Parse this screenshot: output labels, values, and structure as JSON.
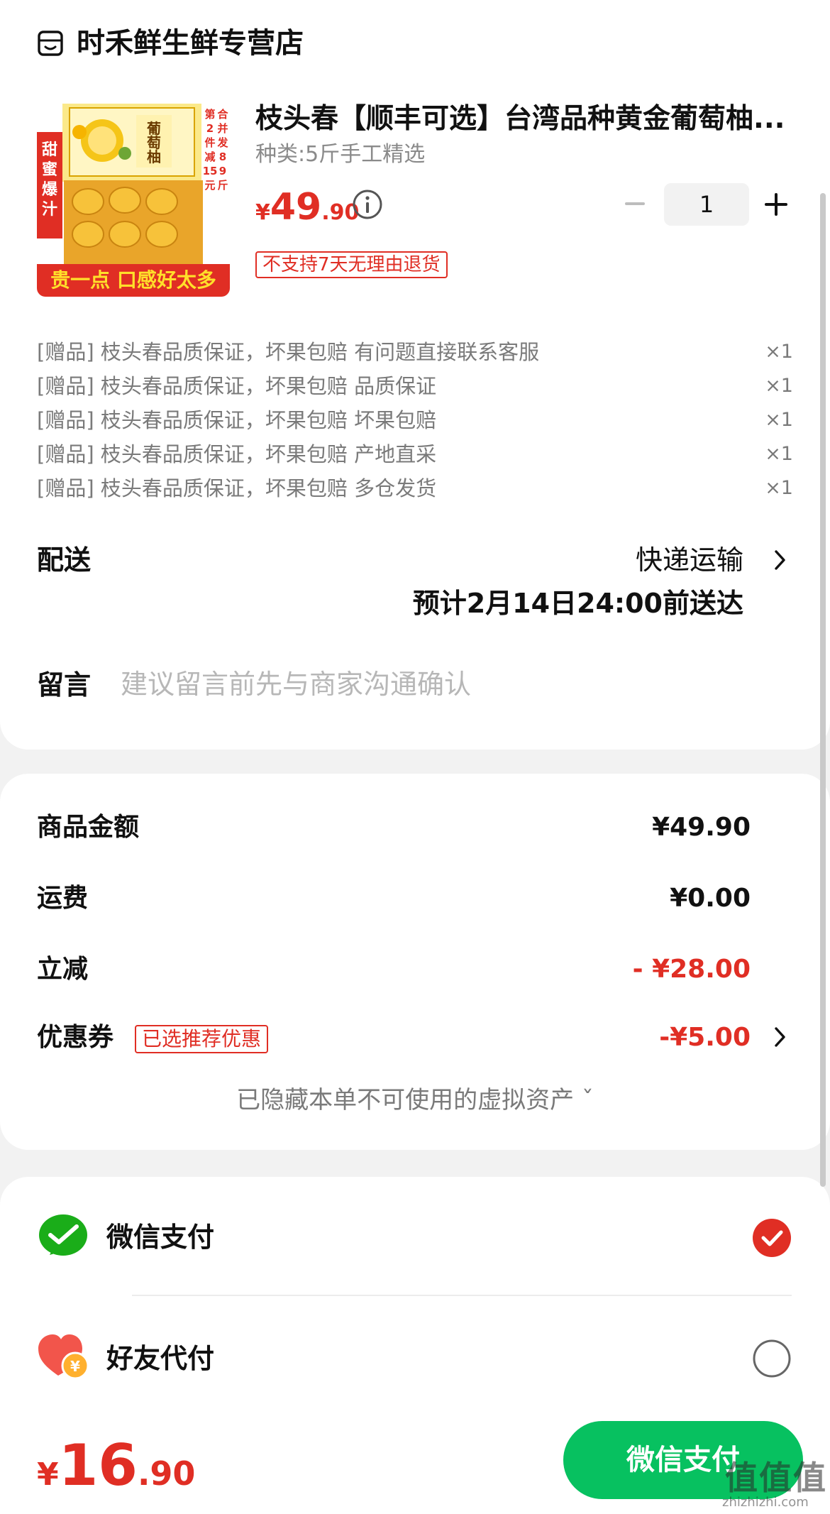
{
  "store": {
    "name": "时禾鲜生鲜专营店",
    "icon": "store-icon"
  },
  "product": {
    "title": "枝头春【顺丰可选】台湾品种黄金葡萄柚...",
    "spec": "种类:5斤手工精选",
    "price": {
      "currency": "¥",
      "integer": "49",
      "decimal": ".90"
    },
    "quantity": "1",
    "return_policy": "不支持7天无理由退货",
    "image_text": {
      "box_title": "葡萄柚",
      "left_banner": "甜蜜爆汁",
      "right_banner": "第2件减15元 合并发8-9斤",
      "bottom_banner": "贵一点 口感好太多"
    }
  },
  "gifts": [
    {
      "text": "[赠品] 枝头春品质保证，坏果包赔 有问题直接联系客服",
      "count": "×1"
    },
    {
      "text": "[赠品] 枝头春品质保证，坏果包赔 品质保证",
      "count": "×1"
    },
    {
      "text": "[赠品] 枝头春品质保证，坏果包赔 坏果包赔",
      "count": "×1"
    },
    {
      "text": "[赠品] 枝头春品质保证，坏果包赔 产地直采",
      "count": "×1"
    },
    {
      "text": "[赠品] 枝头春品质保证，坏果包赔 多仓发货",
      "count": "×1"
    }
  ],
  "delivery": {
    "label": "配送",
    "method": "快递运输",
    "eta": "预计2月14日24:00前送达"
  },
  "message": {
    "label": "留言",
    "placeholder": "建议留言前先与商家沟通确认",
    "value": ""
  },
  "amounts": {
    "goods_label": "商品金额",
    "goods_value": "¥49.90",
    "shipping_label": "运费",
    "shipping_value": "¥0.00",
    "discount_label": "立减",
    "discount_value": "- ¥28.00",
    "coupon_label": "优惠券",
    "coupon_tag": "已选推荐优惠",
    "coupon_value": "-¥5.00",
    "hidden_assets": "已隐藏本单不可使用的虚拟资产 ˇ"
  },
  "payment": {
    "options": [
      {
        "label": "微信支付",
        "icon": "wechat-pay-icon",
        "selected": true
      },
      {
        "label": "好友代付",
        "icon": "friend-pay-icon",
        "selected": false
      }
    ]
  },
  "footer": {
    "total": {
      "currency": "¥",
      "integer": "16",
      "decimal": ".90"
    },
    "pay_button": "微信支付",
    "watermark": "值值值",
    "watermark_url": "zhizhizhi.com"
  },
  "colors": {
    "accent_red": "#e02e24",
    "wechat_green": "#07c160"
  }
}
